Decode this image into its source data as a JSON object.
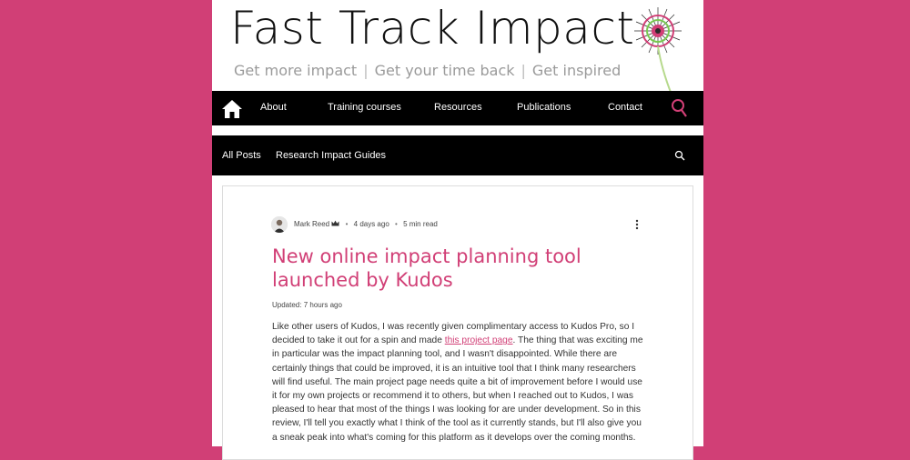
{
  "site": {
    "title": "Fast Track Impact",
    "tagline": [
      "Get more impact",
      "Get your time back",
      "Get inspired"
    ],
    "tagline_separator": "|"
  },
  "mainnav": {
    "home_icon": "home-icon",
    "items": [
      "About",
      "Training courses",
      "Resources",
      "Publications",
      "Contact"
    ],
    "search_icon": "search-icon"
  },
  "blognav": {
    "items": [
      "All Posts",
      "Research Impact Guides"
    ],
    "search_icon": "search-icon"
  },
  "post": {
    "author": "Mark Reed",
    "posted": "4 days ago",
    "read_time": "5 min read",
    "title": "New online impact planning tool launched by Kudos",
    "updated": "Updated: 7 hours ago",
    "body_before_link": "Like other users of Kudos, I was recently given complimentary access to Kudos Pro, so I decided to take it out for a spin and made ",
    "link_text": "this project page",
    "body_after_link": ". The thing that was exciting me in particular was the impact planning tool, and I wasn't disappointed. While there are certainly things that could be improved, it is an intuitive tool that I think many researchers will find useful. The main project page needs quite a bit of improvement before I would use it for my own projects or recommend it to others, but when I reached out to Kudos, I was pleased to hear that most of the things I was looking for are under development. So in this review, I'll tell you exactly what I think of the tool as it currently stands, but I'll also give you a sneak peak into what's coming for this platform as it develops over the coming months."
  },
  "colors": {
    "background": "#d13f76",
    "accent": "#d13f76",
    "nav": "#000000"
  }
}
